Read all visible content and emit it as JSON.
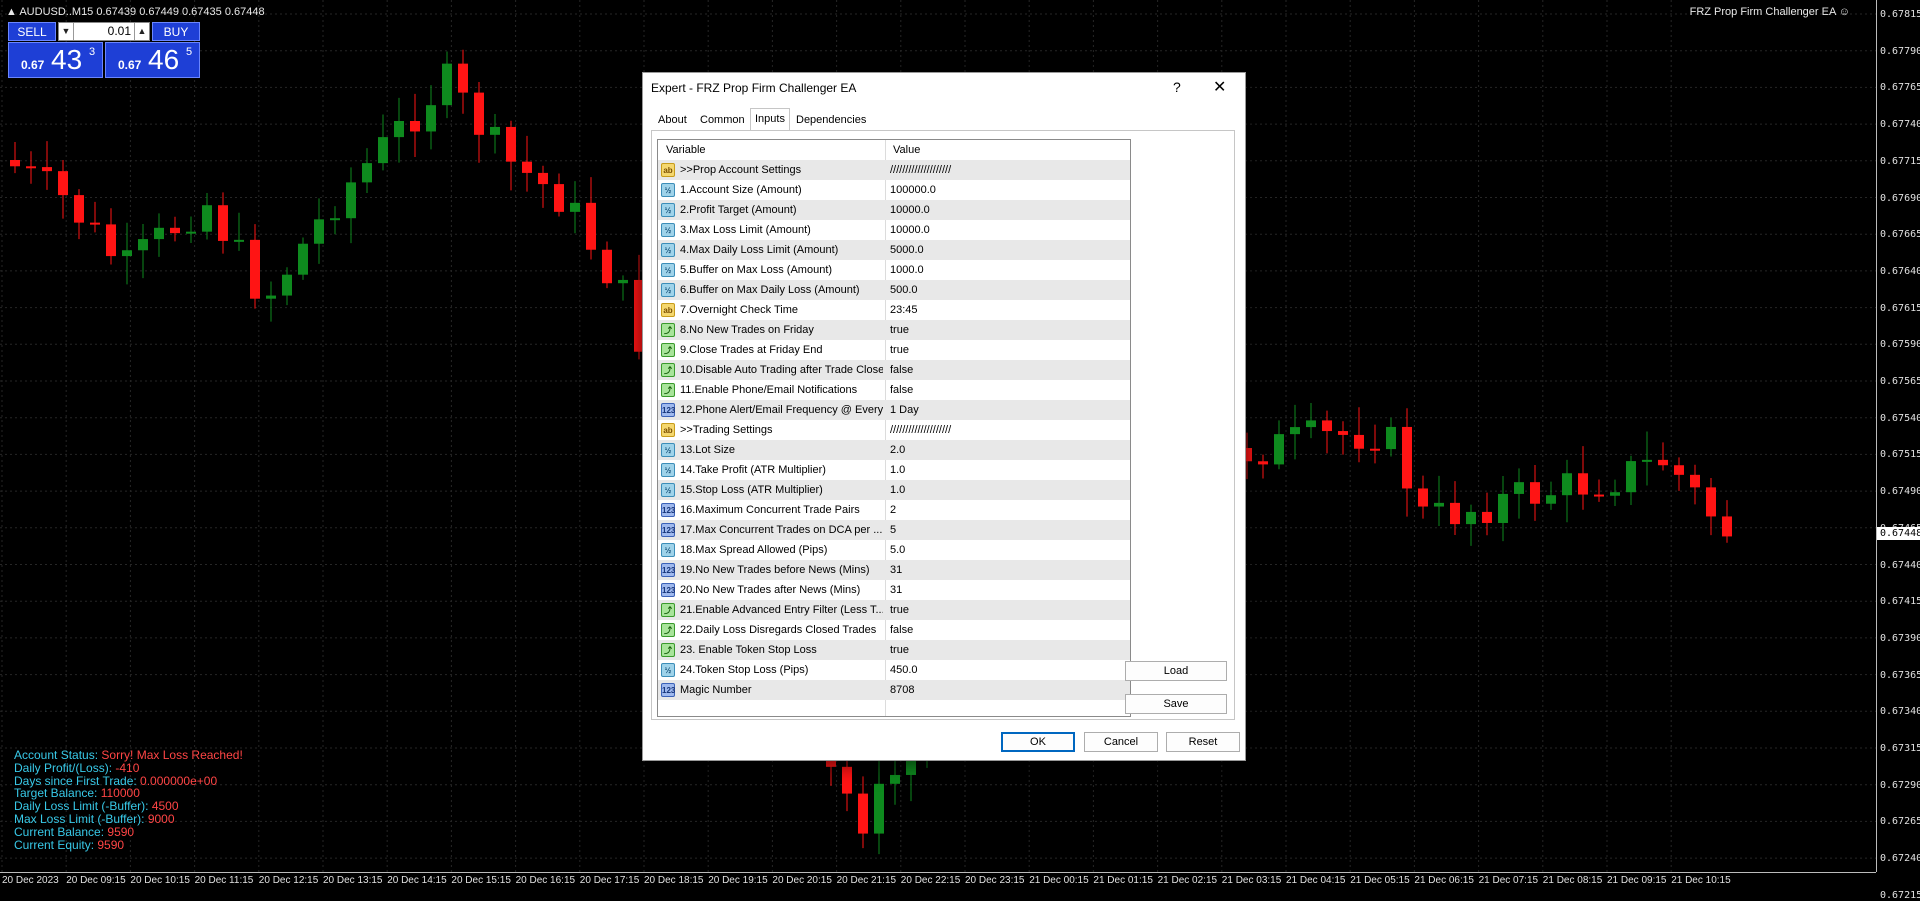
{
  "chart": {
    "symbol_label": "AUDUSD..M15",
    "ohlc": "0.67439 0.67449 0.67435 0.67448",
    "ea_label": "FRZ Prop Firm Challenger EA ☺",
    "current_price": "0.67448",
    "y_ticks": [
      "0.67815",
      "0.67790",
      "0.67765",
      "0.67740",
      "0.67715",
      "0.67690",
      "0.67665",
      "0.67640",
      "0.67615",
      "0.67590",
      "0.67565",
      "0.67540",
      "0.67515",
      "0.67490",
      "0.67465",
      "0.67440",
      "0.67415",
      "0.67390",
      "0.67365",
      "0.67340",
      "0.67315",
      "0.67290",
      "0.67265",
      "0.67240",
      "0.67215"
    ],
    "x_ticks": [
      "20 Dec 2023",
      "20 Dec 09:15",
      "20 Dec 10:15",
      "20 Dec 11:15",
      "20 Dec 12:15",
      "20 Dec 13:15",
      "20 Dec 14:15",
      "20 Dec 15:15",
      "20 Dec 16:15",
      "20 Dec 17:15",
      "20 Dec 18:15",
      "20 Dec 19:15",
      "20 Dec 20:15",
      "20 Dec 21:15",
      "20 Dec 22:15",
      "20 Dec 23:15",
      "21 Dec 00:15",
      "21 Dec 01:15",
      "21 Dec 02:15",
      "21 Dec 03:15",
      "21 Dec 04:15",
      "21 Dec 05:15",
      "21 Dec 06:15",
      "21 Dec 07:15",
      "21 Dec 08:15",
      "21 Dec 09:15",
      "21 Dec 10:15"
    ],
    "colors": {
      "bull": "#0e8a1e",
      "bear": "#ff1414",
      "grid": "#262626"
    }
  },
  "trading": {
    "sell_label": "SELL",
    "buy_label": "BUY",
    "lot": "0.01",
    "sell_small": "0.67",
    "sell_big": "43",
    "sell_sup": "3",
    "buy_small": "0.67",
    "buy_big": "46",
    "buy_sup": "5",
    "down_arrow": "▼",
    "up_arrow": "▲"
  },
  "status": [
    {
      "label": "Account Status: ",
      "value": "Sorry! Max Loss Reached!"
    },
    {
      "label": "Daily Profit/(Loss): ",
      "value": "-410"
    },
    {
      "label": "Days since First Trade: ",
      "value": "0.000000e+00"
    },
    {
      "label": "Target Balance: ",
      "value": "110000"
    },
    {
      "label": "Daily Loss Limit (-Buffer): ",
      "value": "4500"
    },
    {
      "label": "Max Loss Limit (-Buffer): ",
      "value": "9000"
    },
    {
      "label": "Current Balance: ",
      "value": "9590"
    },
    {
      "label": "Current Equity: ",
      "value": "9590"
    }
  ],
  "dialog": {
    "title": "Expert - FRZ Prop Firm Challenger EA",
    "help": "?",
    "close": "✕",
    "tabs": [
      "About",
      "Common",
      "Inputs",
      "Dependencies"
    ],
    "active_tab": "Inputs",
    "col_variable": "Variable",
    "col_value": "Value",
    "rows": [
      {
        "type": "ab",
        "variable": ">>Prop Account Settings",
        "value": "////////////////////"
      },
      {
        "type": "num",
        "variable": "1.Account Size (Amount)",
        "value": "100000.0"
      },
      {
        "type": "num",
        "variable": "2.Profit Target (Amount)",
        "value": "10000.0"
      },
      {
        "type": "num",
        "variable": "3.Max Loss Limit (Amount)",
        "value": "10000.0"
      },
      {
        "type": "num",
        "variable": "4.Max Daily Loss Limit (Amount)",
        "value": "5000.0"
      },
      {
        "type": "num",
        "variable": "5.Buffer on Max Loss (Amount)",
        "value": "1000.0"
      },
      {
        "type": "num",
        "variable": "6.Buffer on Max Daily Loss (Amount)",
        "value": "500.0"
      },
      {
        "type": "ab",
        "variable": "7.Overnight Check Time",
        "value": "23:45"
      },
      {
        "type": "boo",
        "variable": "8.No New Trades on Friday",
        "value": "true"
      },
      {
        "type": "boo",
        "variable": "9.Close Trades at Friday End",
        "value": "true"
      },
      {
        "type": "boo",
        "variable": "10.Disable Auto Trading after Trade Close",
        "value": "false"
      },
      {
        "type": "boo",
        "variable": "11.Enable Phone/Email Notifications",
        "value": "false"
      },
      {
        "type": "int",
        "variable": "12.Phone Alert/Email Frequency @ Every",
        "value": "1 Day"
      },
      {
        "type": "ab",
        "variable": ">>Trading Settings",
        "value": "////////////////////"
      },
      {
        "type": "num",
        "variable": "13.Lot Size",
        "value": "2.0"
      },
      {
        "type": "num",
        "variable": "14.Take Profit (ATR Multiplier)",
        "value": "1.0"
      },
      {
        "type": "num",
        "variable": "15.Stop Loss (ATR Multiplier)",
        "value": "1.0"
      },
      {
        "type": "int",
        "variable": "16.Maximum Concurrent Trade Pairs",
        "value": "2"
      },
      {
        "type": "int",
        "variable": "17.Max Concurrent Trades on DCA per ...",
        "value": "5"
      },
      {
        "type": "num",
        "variable": "18.Max Spread Allowed (Pips)",
        "value": "5.0"
      },
      {
        "type": "int",
        "variable": "19.No New Trades before News (Mins)",
        "value": "31"
      },
      {
        "type": "int",
        "variable": "20.No New Trades after News (Mins)",
        "value": "31"
      },
      {
        "type": "boo",
        "variable": "21.Enable Advanced Entry Filter (Less T...",
        "value": "true"
      },
      {
        "type": "boo",
        "variable": "22.Daily Loss Disregards Closed Trades",
        "value": "false"
      },
      {
        "type": "boo",
        "variable": "23. Enable Token Stop Loss",
        "value": "true"
      },
      {
        "type": "num",
        "variable": "24.Token Stop Loss (Pips)",
        "value": "450.0"
      },
      {
        "type": "int",
        "variable": "Magic Number",
        "value": "8708"
      }
    ],
    "icon_text": {
      "ab": "ab",
      "num": "½",
      "boo": "⤴",
      "int": "123"
    },
    "load": "Load",
    "save": "Save",
    "ok": "OK",
    "cancel": "Cancel",
    "reset": "Reset"
  }
}
